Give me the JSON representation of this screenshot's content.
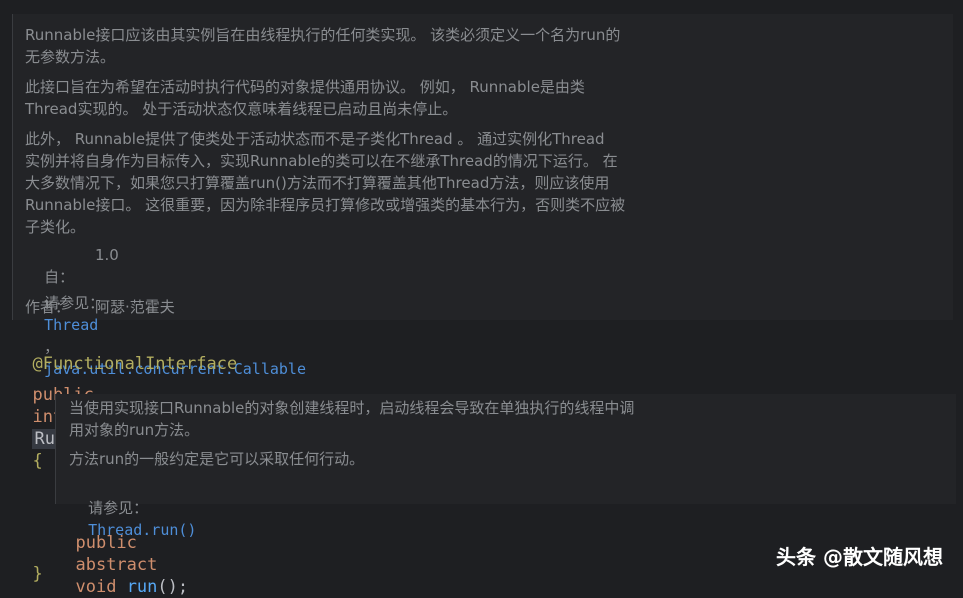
{
  "doc_top": {
    "p1": [
      "Runnable接口应该由其实例旨在由线程执行的任何类实现。 该类必须定义一个名为run的",
      "无参数方法。"
    ],
    "p2": [
      "此接口旨在为希望在活动时执行代码的对象提供通用协议。 例如， Runnable是由类",
      "Thread实现的。 处于活动状态仅意味着线程已启动且尚未停止。"
    ],
    "p3": [
      "此外， Runnable提供了使类处于活动状态而不是子类化Thread 。 通过实例化Thread",
      "实例并将自身作为目标传入，实现Runnable的类可以在不继承Thread的情况下运行。 在",
      "大多数情况下，如果您只打算覆盖run()方法而不打算覆盖其他Thread方法，则应该使用",
      "Runnable接口。 这很重要，因为除非程序员打算修改或增强类的基本行为，否则类不应被",
      "子类化。"
    ],
    "since_label": "自：",
    "since_value": "1.0",
    "see_label": "请参见：",
    "see_link1": "Thread",
    "see_sep": "，",
    "see_link2": "java.util.concurrent.Callable",
    "author_label": "作者：",
    "author_value": "阿瑟·范霍夫"
  },
  "code": {
    "annotation": "@FunctionalInterface",
    "kw_public": "public",
    "kw_interface": "interface",
    "class_name": "Runnable",
    "open_brace": "{",
    "method_public": "public",
    "method_abstract": "abstract",
    "method_void": "void",
    "method_name": "run",
    "method_tail": "();",
    "close_brace": "}"
  },
  "doc_inner": {
    "p1": [
      "当使用实现接口Runnable的对象创建线程时，启动线程会导致在单独执行的线程中调",
      "用对象的run方法。"
    ],
    "p2": "方法run的一般约定是它可以采取任何行动。",
    "see_label": "请参见：",
    "see_link": "Thread.run()"
  },
  "watermark": "头条 @散文随风想",
  "colors": {
    "background": "#1e1f22",
    "doc_background": "#232427",
    "keyword": "#cf8e6d",
    "annotation": "#b3ae60",
    "method": "#56a8f5",
    "link": "#4e8ed8",
    "doc_text": "#8a8d91"
  }
}
